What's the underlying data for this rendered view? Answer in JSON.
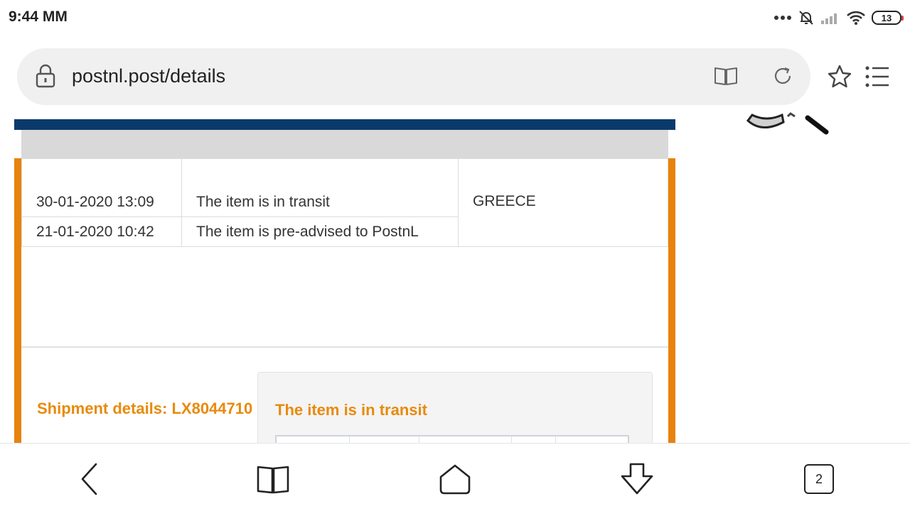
{
  "status_bar": {
    "time": "9:44 MM",
    "battery_level": "13",
    "icons": [
      "more-dots-icon",
      "mute-notifications-icon",
      "signal-icon",
      "wifi-icon",
      "battery-icon"
    ]
  },
  "browser": {
    "url": "postnl.post/details",
    "icons": [
      "lock-icon",
      "reader-mode-icon",
      "reload-icon",
      "star-icon",
      "menu-icon"
    ]
  },
  "events": [
    {
      "datetime": "30-01-2020 13:09",
      "description": "The item is in transit"
    },
    {
      "datetime": "21-01-2020 10:42",
      "description": "The item is pre-advised to PostnL"
    }
  ],
  "location": "GREECE",
  "shipment_title": "Shipment details: LX8044710",
  "popup": {
    "title": "The item is in transit"
  },
  "bottom_nav": {
    "tab_count": "2",
    "icons": [
      "back-icon",
      "bookmarks-icon",
      "home-icon",
      "download-icon",
      "tabs-icon"
    ]
  },
  "colors": {
    "accent_orange": "#e8820c",
    "header_blue": "#0a3a6b",
    "header_gray": "#d9d9d9"
  }
}
